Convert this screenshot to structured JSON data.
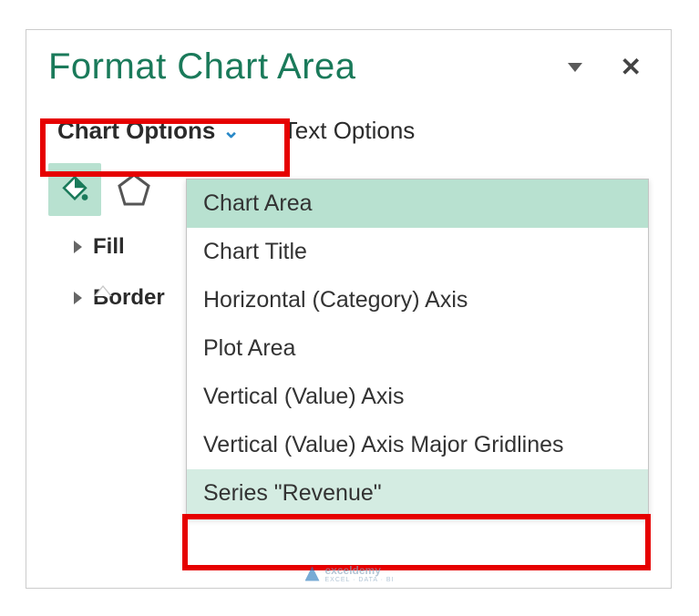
{
  "panel": {
    "title": "Format Chart Area"
  },
  "tabs": {
    "chart_options": "Chart Options",
    "text_options": "Text Options"
  },
  "sections": {
    "fill": "Fill",
    "border": "Border"
  },
  "dropdown": {
    "items": [
      {
        "label": "Chart Area",
        "selected": true
      },
      {
        "label": "Chart Title",
        "selected": false
      },
      {
        "label": "Horizontal (Category) Axis",
        "selected": false
      },
      {
        "label": "Plot Area",
        "selected": false
      },
      {
        "label": "Vertical (Value) Axis",
        "selected": false
      },
      {
        "label": "Vertical (Value) Axis Major Gridlines",
        "selected": false
      },
      {
        "label": "Series \"Revenue\"",
        "selected": false,
        "hover": true
      }
    ]
  },
  "watermark": {
    "brand": "exceldemy",
    "tagline": "EXCEL · DATA · BI"
  }
}
